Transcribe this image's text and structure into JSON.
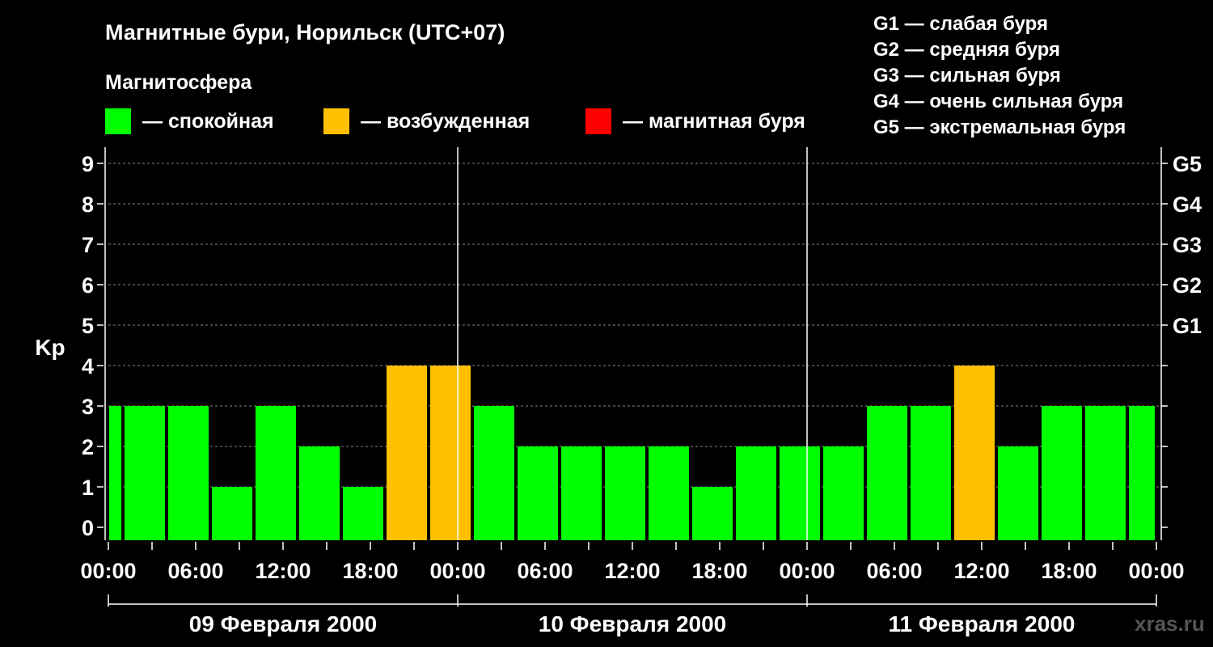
{
  "chart_data": {
    "type": "bar",
    "title": "Магнитные бури, Норильск (UTC+07)",
    "legend_title": "Магнитосфера",
    "legend": [
      {
        "label": "— спокойная",
        "color": "#00ff00"
      },
      {
        "label": "— возбужденная",
        "color": "#ffc000"
      },
      {
        "label": "— магнитная буря",
        "color": "#ff0000"
      }
    ],
    "storm_scale": [
      "G1 — слабая буря",
      "G2 — средняя буря",
      "G3 — сильная буря",
      "G4 — очень сильная буря",
      "G5 — экстремальная буря"
    ],
    "ylabel": "Kp",
    "ylim": [
      0,
      9
    ],
    "y_ticks": [
      "0",
      "1",
      "2",
      "3",
      "4",
      "5",
      "6",
      "7",
      "8",
      "9"
    ],
    "right_axis_labels": [
      {
        "y": 5,
        "label": "G1"
      },
      {
        "y": 6,
        "label": "G2"
      },
      {
        "y": 7,
        "label": "G3"
      },
      {
        "y": 8,
        "label": "G4"
      },
      {
        "y": 9,
        "label": "G5"
      }
    ],
    "x_start": "2000-02-09 00:00",
    "x_end": "2000-02-12 00:00",
    "x_tick_labels": [
      "00:00",
      "06:00",
      "12:00",
      "18:00",
      "00:00",
      "06:00",
      "12:00",
      "18:00",
      "00:00",
      "06:00",
      "12:00",
      "18:00",
      "00:00"
    ],
    "days": [
      "09 Февраля 2000",
      "10 Февраля 2000",
      "11 Февраля 2000"
    ],
    "bars": [
      {
        "start": "2000-02-09 00:00",
        "end": "2000-02-09 01:00",
        "kp": 3
      },
      {
        "start": "2000-02-09 01:00",
        "end": "2000-02-09 04:00",
        "kp": 3
      },
      {
        "start": "2000-02-09 04:00",
        "end": "2000-02-09 07:00",
        "kp": 3
      },
      {
        "start": "2000-02-09 07:00",
        "end": "2000-02-09 10:00",
        "kp": 1
      },
      {
        "start": "2000-02-09 10:00",
        "end": "2000-02-09 13:00",
        "kp": 3
      },
      {
        "start": "2000-02-09 13:00",
        "end": "2000-02-09 16:00",
        "kp": 2
      },
      {
        "start": "2000-02-09 16:00",
        "end": "2000-02-09 19:00",
        "kp": 1
      },
      {
        "start": "2000-02-09 19:00",
        "end": "2000-02-09 22:00",
        "kp": 4
      },
      {
        "start": "2000-02-09 22:00",
        "end": "2000-02-10 01:00",
        "kp": 4
      },
      {
        "start": "2000-02-10 01:00",
        "end": "2000-02-10 04:00",
        "kp": 3
      },
      {
        "start": "2000-02-10 04:00",
        "end": "2000-02-10 07:00",
        "kp": 2
      },
      {
        "start": "2000-02-10 07:00",
        "end": "2000-02-10 10:00",
        "kp": 2
      },
      {
        "start": "2000-02-10 10:00",
        "end": "2000-02-10 13:00",
        "kp": 2
      },
      {
        "start": "2000-02-10 13:00",
        "end": "2000-02-10 16:00",
        "kp": 2
      },
      {
        "start": "2000-02-10 16:00",
        "end": "2000-02-10 19:00",
        "kp": 1
      },
      {
        "start": "2000-02-10 19:00",
        "end": "2000-02-10 22:00",
        "kp": 2
      },
      {
        "start": "2000-02-10 22:00",
        "end": "2000-02-11 01:00",
        "kp": 2
      },
      {
        "start": "2000-02-11 01:00",
        "end": "2000-02-11 04:00",
        "kp": 2
      },
      {
        "start": "2000-02-11 04:00",
        "end": "2000-02-11 07:00",
        "kp": 3
      },
      {
        "start": "2000-02-11 07:00",
        "end": "2000-02-11 10:00",
        "kp": 3
      },
      {
        "start": "2000-02-11 10:00",
        "end": "2000-02-11 13:00",
        "kp": 4
      },
      {
        "start": "2000-02-11 13:00",
        "end": "2000-02-11 16:00",
        "kp": 2
      },
      {
        "start": "2000-02-11 16:00",
        "end": "2000-02-11 19:00",
        "kp": 3
      },
      {
        "start": "2000-02-11 19:00",
        "end": "2000-02-11 22:00",
        "kp": 3
      },
      {
        "start": "2000-02-11 22:00",
        "end": "2000-02-12 00:00",
        "kp": 3
      }
    ],
    "level_colors": {
      "quiet": "#00ff00",
      "active": "#ffc000",
      "storm": "#ff0000"
    },
    "grid": "dashed horizontal",
    "watermark": "xras.ru"
  }
}
